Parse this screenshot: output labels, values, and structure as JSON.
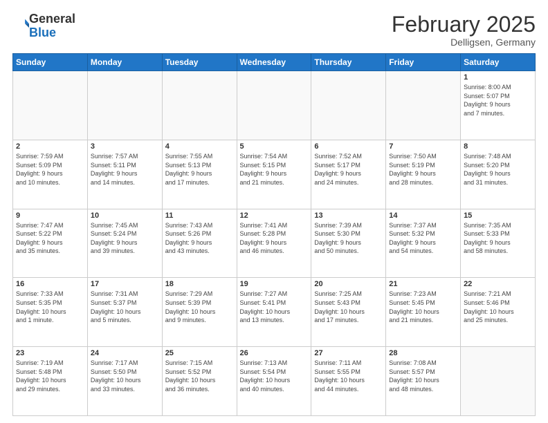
{
  "header": {
    "logo": {
      "general": "General",
      "blue": "Blue"
    },
    "title": "February 2025",
    "location": "Delligsen, Germany"
  },
  "days_of_week": [
    "Sunday",
    "Monday",
    "Tuesday",
    "Wednesday",
    "Thursday",
    "Friday",
    "Saturday"
  ],
  "weeks": [
    [
      {
        "day": "",
        "info": ""
      },
      {
        "day": "",
        "info": ""
      },
      {
        "day": "",
        "info": ""
      },
      {
        "day": "",
        "info": ""
      },
      {
        "day": "",
        "info": ""
      },
      {
        "day": "",
        "info": ""
      },
      {
        "day": "1",
        "info": "Sunrise: 8:00 AM\nSunset: 5:07 PM\nDaylight: 9 hours\nand 7 minutes."
      }
    ],
    [
      {
        "day": "2",
        "info": "Sunrise: 7:59 AM\nSunset: 5:09 PM\nDaylight: 9 hours\nand 10 minutes."
      },
      {
        "day": "3",
        "info": "Sunrise: 7:57 AM\nSunset: 5:11 PM\nDaylight: 9 hours\nand 14 minutes."
      },
      {
        "day": "4",
        "info": "Sunrise: 7:55 AM\nSunset: 5:13 PM\nDaylight: 9 hours\nand 17 minutes."
      },
      {
        "day": "5",
        "info": "Sunrise: 7:54 AM\nSunset: 5:15 PM\nDaylight: 9 hours\nand 21 minutes."
      },
      {
        "day": "6",
        "info": "Sunrise: 7:52 AM\nSunset: 5:17 PM\nDaylight: 9 hours\nand 24 minutes."
      },
      {
        "day": "7",
        "info": "Sunrise: 7:50 AM\nSunset: 5:19 PM\nDaylight: 9 hours\nand 28 minutes."
      },
      {
        "day": "8",
        "info": "Sunrise: 7:48 AM\nSunset: 5:20 PM\nDaylight: 9 hours\nand 31 minutes."
      }
    ],
    [
      {
        "day": "9",
        "info": "Sunrise: 7:47 AM\nSunset: 5:22 PM\nDaylight: 9 hours\nand 35 minutes."
      },
      {
        "day": "10",
        "info": "Sunrise: 7:45 AM\nSunset: 5:24 PM\nDaylight: 9 hours\nand 39 minutes."
      },
      {
        "day": "11",
        "info": "Sunrise: 7:43 AM\nSunset: 5:26 PM\nDaylight: 9 hours\nand 43 minutes."
      },
      {
        "day": "12",
        "info": "Sunrise: 7:41 AM\nSunset: 5:28 PM\nDaylight: 9 hours\nand 46 minutes."
      },
      {
        "day": "13",
        "info": "Sunrise: 7:39 AM\nSunset: 5:30 PM\nDaylight: 9 hours\nand 50 minutes."
      },
      {
        "day": "14",
        "info": "Sunrise: 7:37 AM\nSunset: 5:32 PM\nDaylight: 9 hours\nand 54 minutes."
      },
      {
        "day": "15",
        "info": "Sunrise: 7:35 AM\nSunset: 5:33 PM\nDaylight: 9 hours\nand 58 minutes."
      }
    ],
    [
      {
        "day": "16",
        "info": "Sunrise: 7:33 AM\nSunset: 5:35 PM\nDaylight: 10 hours\nand 1 minute."
      },
      {
        "day": "17",
        "info": "Sunrise: 7:31 AM\nSunset: 5:37 PM\nDaylight: 10 hours\nand 5 minutes."
      },
      {
        "day": "18",
        "info": "Sunrise: 7:29 AM\nSunset: 5:39 PM\nDaylight: 10 hours\nand 9 minutes."
      },
      {
        "day": "19",
        "info": "Sunrise: 7:27 AM\nSunset: 5:41 PM\nDaylight: 10 hours\nand 13 minutes."
      },
      {
        "day": "20",
        "info": "Sunrise: 7:25 AM\nSunset: 5:43 PM\nDaylight: 10 hours\nand 17 minutes."
      },
      {
        "day": "21",
        "info": "Sunrise: 7:23 AM\nSunset: 5:45 PM\nDaylight: 10 hours\nand 21 minutes."
      },
      {
        "day": "22",
        "info": "Sunrise: 7:21 AM\nSunset: 5:46 PM\nDaylight: 10 hours\nand 25 minutes."
      }
    ],
    [
      {
        "day": "23",
        "info": "Sunrise: 7:19 AM\nSunset: 5:48 PM\nDaylight: 10 hours\nand 29 minutes."
      },
      {
        "day": "24",
        "info": "Sunrise: 7:17 AM\nSunset: 5:50 PM\nDaylight: 10 hours\nand 33 minutes."
      },
      {
        "day": "25",
        "info": "Sunrise: 7:15 AM\nSunset: 5:52 PM\nDaylight: 10 hours\nand 36 minutes."
      },
      {
        "day": "26",
        "info": "Sunrise: 7:13 AM\nSunset: 5:54 PM\nDaylight: 10 hours\nand 40 minutes."
      },
      {
        "day": "27",
        "info": "Sunrise: 7:11 AM\nSunset: 5:55 PM\nDaylight: 10 hours\nand 44 minutes."
      },
      {
        "day": "28",
        "info": "Sunrise: 7:08 AM\nSunset: 5:57 PM\nDaylight: 10 hours\nand 48 minutes."
      },
      {
        "day": "",
        "info": ""
      }
    ]
  ]
}
